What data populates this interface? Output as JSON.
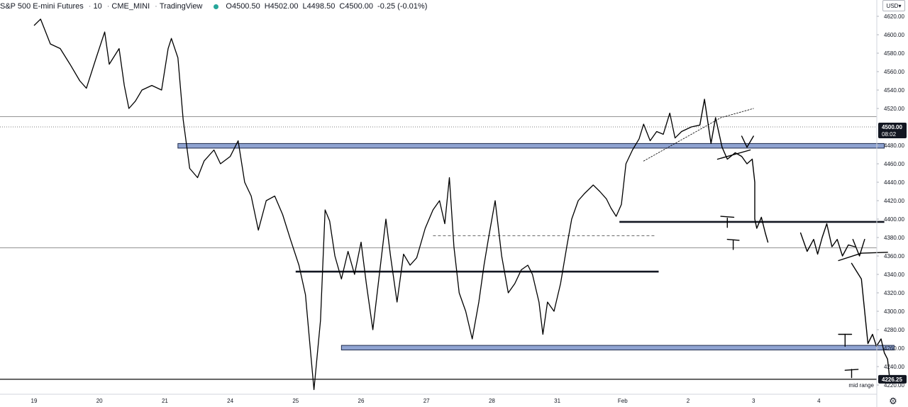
{
  "header": {
    "symbol": "S&P 500 E-mini Futures",
    "interval": "10",
    "exchange": "CME_MINI",
    "source": "TradingView",
    "status_color": "#26a69a",
    "ohlc": [
      {
        "k": "O",
        "v": "4500.50"
      },
      {
        "k": "H",
        "v": "4502.00"
      },
      {
        "k": "L",
        "v": "4498.50"
      },
      {
        "k": "C",
        "v": "4500.00"
      }
    ],
    "change": "-0.25 (-0.01%)"
  },
  "currency_button": "USD",
  "settings_icon": "gear-icon",
  "chart_data": {
    "type": "line",
    "price_axis": {
      "ticks": [
        "4620.00",
        "4600.00",
        "4580.00",
        "4560.00",
        "4540.00",
        "4520.00",
        "4480.00",
        "4460.00",
        "4440.00",
        "4420.00",
        "4400.00",
        "4380.00",
        "4360.00",
        "4340.00",
        "4320.00",
        "4300.00",
        "4280.00",
        "4260.00",
        "4240.00",
        "4220.00"
      ],
      "range": [
        4215,
        4625
      ]
    },
    "time_axis": [
      "19",
      "20",
      "21",
      "24",
      "25",
      "26",
      "27",
      "28",
      "31",
      "Feb",
      "2",
      "3",
      "4"
    ],
    "last_price": {
      "value": "4500.00",
      "countdown": "08:02"
    },
    "mid_range": {
      "value": "4226.25",
      "label": "mid range"
    },
    "zones": [
      {
        "from_day": 2.2,
        "to_day": 13.0,
        "low": 4477,
        "high": 4482,
        "color": "#8fa3d1"
      },
      {
        "from_day": 4.7,
        "to_day": 13.15,
        "low": 4258,
        "high": 4263,
        "color": "#8fa3d1"
      }
    ],
    "levels": [
      {
        "price": 4511,
        "style": "thin"
      },
      {
        "price": 4369,
        "style": "thin"
      },
      {
        "price": 4226.25,
        "style": "thin-bold"
      },
      {
        "price": 4500,
        "style": "dotted"
      },
      {
        "price": 4343,
        "from_day": 4.0,
        "to_day": 9.55,
        "style": "thick"
      },
      {
        "price": 4397,
        "from_day": 8.95,
        "to_day": 13.0,
        "style": "thick"
      },
      {
        "price": 4382,
        "from_day": 6.1,
        "to_day": 9.5,
        "style": "dashed"
      }
    ],
    "price_path": [
      [
        0.0,
        4610
      ],
      [
        0.1,
        4617
      ],
      [
        0.25,
        4590
      ],
      [
        0.4,
        4585
      ],
      [
        0.55,
        4568
      ],
      [
        0.7,
        4550
      ],
      [
        0.8,
        4542
      ],
      [
        0.95,
        4575
      ],
      [
        1.08,
        4603
      ],
      [
        1.15,
        4568
      ],
      [
        1.3,
        4585
      ],
      [
        1.38,
        4545
      ],
      [
        1.45,
        4520
      ],
      [
        1.55,
        4528
      ],
      [
        1.65,
        4540
      ],
      [
        1.8,
        4545
      ],
      [
        1.95,
        4540
      ],
      [
        2.05,
        4585
      ],
      [
        2.1,
        4596
      ],
      [
        2.2,
        4575
      ],
      [
        2.28,
        4508
      ],
      [
        2.38,
        4455
      ],
      [
        2.5,
        4445
      ],
      [
        2.6,
        4463
      ],
      [
        2.75,
        4475
      ],
      [
        2.85,
        4460
      ],
      [
        3.0,
        4468
      ],
      [
        3.12,
        4485
      ],
      [
        3.22,
        4440
      ],
      [
        3.32,
        4425
      ],
      [
        3.43,
        4388
      ],
      [
        3.55,
        4420
      ],
      [
        3.68,
        4425
      ],
      [
        3.8,
        4405
      ],
      [
        3.92,
        4378
      ],
      [
        4.05,
        4350
      ],
      [
        4.15,
        4318
      ],
      [
        4.22,
        4262
      ],
      [
        4.28,
        4215
      ],
      [
        4.32,
        4245
      ],
      [
        4.38,
        4290
      ],
      [
        4.45,
        4410
      ],
      [
        4.52,
        4398
      ],
      [
        4.6,
        4360
      ],
      [
        4.7,
        4335
      ],
      [
        4.8,
        4365
      ],
      [
        4.9,
        4340
      ],
      [
        5.0,
        4375
      ],
      [
        5.08,
        4330
      ],
      [
        5.18,
        4280
      ],
      [
        5.28,
        4340
      ],
      [
        5.38,
        4400
      ],
      [
        5.45,
        4360
      ],
      [
        5.55,
        4310
      ],
      [
        5.65,
        4362
      ],
      [
        5.75,
        4350
      ],
      [
        5.85,
        4358
      ],
      [
        5.98,
        4390
      ],
      [
        6.1,
        4410
      ],
      [
        6.2,
        4420
      ],
      [
        6.28,
        4395
      ],
      [
        6.35,
        4445
      ],
      [
        6.42,
        4370
      ],
      [
        6.5,
        4320
      ],
      [
        6.6,
        4300
      ],
      [
        6.7,
        4270
      ],
      [
        6.8,
        4310
      ],
      [
        6.88,
        4350
      ],
      [
        6.95,
        4380
      ],
      [
        7.05,
        4420
      ],
      [
        7.15,
        4360
      ],
      [
        7.25,
        4320
      ],
      [
        7.35,
        4330
      ],
      [
        7.45,
        4345
      ],
      [
        7.55,
        4350
      ],
      [
        7.62,
        4340
      ],
      [
        7.72,
        4310
      ],
      [
        7.78,
        4275
      ],
      [
        7.85,
        4310
      ],
      [
        7.95,
        4300
      ],
      [
        8.05,
        4330
      ],
      [
        8.15,
        4372
      ],
      [
        8.22,
        4400
      ],
      [
        8.32,
        4420
      ],
      [
        8.42,
        4428
      ],
      [
        8.55,
        4437
      ],
      [
        8.65,
        4430
      ],
      [
        8.75,
        4422
      ],
      [
        8.82,
        4412
      ],
      [
        8.9,
        4403
      ],
      [
        8.98,
        4416
      ],
      [
        9.05,
        4460
      ],
      [
        9.15,
        4475
      ],
      [
        9.25,
        4487
      ],
      [
        9.32,
        4503
      ],
      [
        9.42,
        4485
      ],
      [
        9.52,
        4495
      ],
      [
        9.62,
        4492
      ],
      [
        9.72,
        4515
      ],
      [
        9.8,
        4488
      ],
      [
        9.9,
        4495
      ],
      [
        10.05,
        4500
      ]
    ],
    "annotation_strokes": [
      [
        [
          9.32,
          4463
        ],
        [
          9.95,
          4488
        ],
        [
          10.5,
          4510
        ],
        [
          11.0,
          4520
        ]
      ],
      [
        [
          10.05,
          4500
        ],
        [
          10.18,
          4502
        ],
        [
          10.25,
          4530
        ],
        [
          10.35,
          4482
        ],
        [
          10.42,
          4510
        ],
        [
          10.52,
          4478
        ],
        [
          10.6,
          4465
        ],
        [
          10.72,
          4472
        ],
        [
          10.82,
          4468
        ],
        [
          10.9,
          4460
        ],
        [
          10.98,
          4465
        ]
      ],
      [
        [
          10.45,
          4465
        ],
        [
          10.95,
          4475
        ]
      ],
      [
        [
          10.82,
          4490
        ],
        [
          10.9,
          4478
        ],
        [
          11.0,
          4490
        ]
      ],
      [
        [
          10.98,
          4465
        ],
        [
          11.02,
          4440
        ],
        [
          11.02,
          4400
        ],
        [
          11.05,
          4390
        ],
        [
          11.12,
          4402
        ],
        [
          11.18,
          4385
        ],
        [
          11.22,
          4375
        ]
      ],
      [
        [
          10.5,
          4403
        ],
        [
          10.7,
          4402
        ]
      ],
      [
        [
          10.6,
          4401
        ],
        [
          10.6,
          4391
        ]
      ],
      [
        [
          10.6,
          4378
        ],
        [
          10.78,
          4377
        ]
      ],
      [
        [
          10.69,
          4377
        ],
        [
          10.69,
          4367
        ]
      ],
      [
        [
          11.72,
          4385
        ],
        [
          11.82,
          4365
        ],
        [
          11.92,
          4378
        ],
        [
          11.98,
          4362
        ],
        [
          12.05,
          4380
        ],
        [
          12.12,
          4395
        ],
        [
          12.2,
          4370
        ],
        [
          12.28,
          4378
        ],
        [
          12.36,
          4360
        ],
        [
          12.45,
          4372
        ],
        [
          12.55,
          4370
        ]
      ],
      [
        [
          12.3,
          4355
        ],
        [
          12.65,
          4363
        ],
        [
          13.05,
          4364
        ]
      ],
      [
        [
          12.52,
          4378
        ],
        [
          12.62,
          4360
        ],
        [
          12.7,
          4378
        ]
      ],
      [
        [
          12.5,
          4352
        ],
        [
          12.65,
          4335
        ],
        [
          12.75,
          4265
        ],
        [
          12.82,
          4275
        ],
        [
          12.88,
          4262
        ],
        [
          12.95,
          4270
        ],
        [
          13.0,
          4255
        ],
        [
          13.05,
          4248
        ],
        [
          13.08,
          4228
        ]
      ],
      [
        [
          12.3,
          4275
        ],
        [
          12.5,
          4275
        ]
      ],
      [
        [
          12.4,
          4275
        ],
        [
          12.4,
          4262
        ]
      ],
      [
        [
          12.4,
          4236
        ],
        [
          12.6,
          4237
        ]
      ],
      [
        [
          12.5,
          4237
        ],
        [
          12.5,
          4228
        ]
      ]
    ]
  }
}
